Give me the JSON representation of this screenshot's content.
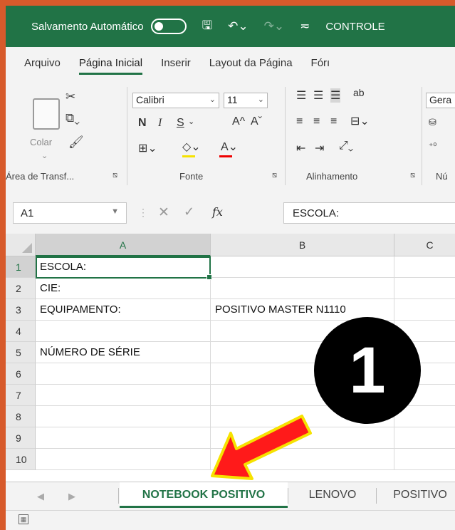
{
  "titlebar": {
    "autosave_label": "Salvamento Automático",
    "filename": "CONTROLE"
  },
  "ribbon_tabs": [
    "Arquivo",
    "Página Inicial",
    "Inserir",
    "Layout da Página",
    "Fórı"
  ],
  "ribbon": {
    "clipboard": {
      "paste_label": "Colar",
      "group_label": "Área de Transf..."
    },
    "font": {
      "name": "Calibri",
      "size": "11",
      "bold": "N",
      "italic": "I",
      "underline": "S",
      "grow": "A^",
      "shrink": "Aˇ",
      "group_label": "Fonte"
    },
    "alignment": {
      "group_label": "Alinhamento"
    },
    "number": {
      "format": "Gera",
      "group_label": "Nú"
    }
  },
  "formula_bar": {
    "name_box": "A1",
    "fx": "fx",
    "content": "ESCOLA:"
  },
  "grid": {
    "columns": [
      "A",
      "B",
      "C"
    ],
    "rows": [
      {
        "num": "1",
        "a": "ESCOLA:",
        "b": ""
      },
      {
        "num": "2",
        "a": "CIE:",
        "b": ""
      },
      {
        "num": "3",
        "a": "EQUIPAMENTO:",
        "b": "POSITIVO MASTER N1110"
      },
      {
        "num": "4",
        "a": "",
        "b": ""
      },
      {
        "num": "5",
        "a": "NÚMERO DE SÉRIE",
        "b": ""
      },
      {
        "num": "6",
        "a": "",
        "b": ""
      },
      {
        "num": "7",
        "a": "",
        "b": ""
      },
      {
        "num": "8",
        "a": "",
        "b": ""
      },
      {
        "num": "9",
        "a": "",
        "b": ""
      },
      {
        "num": "10",
        "a": "",
        "b": ""
      }
    ]
  },
  "sheets": [
    "NOTEBOOK POSITIVO",
    "LENOVO",
    "POSITIVO"
  ],
  "overlay": {
    "badge_number": "1"
  },
  "colors": {
    "excel_green": "#217346",
    "frame_orange": "#d75a2b",
    "arrow_red": "#ff1a1a",
    "arrow_outline": "#f6e200"
  }
}
